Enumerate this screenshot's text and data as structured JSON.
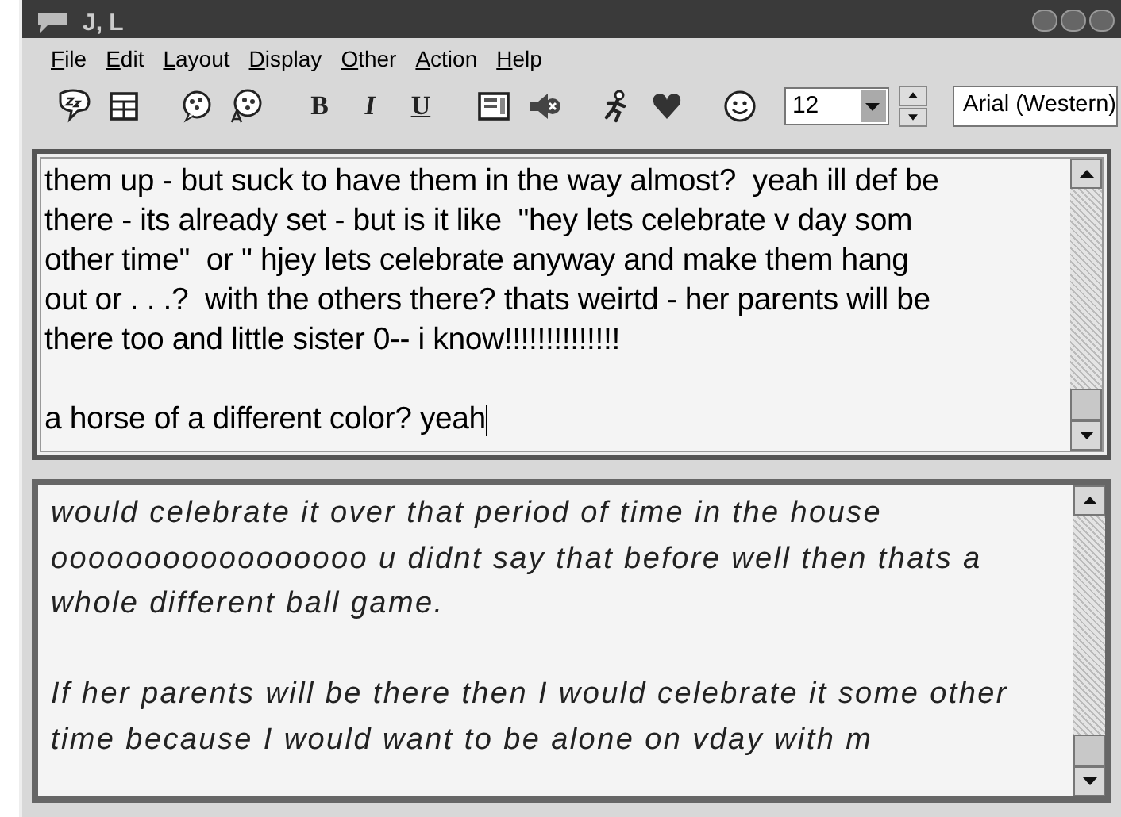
{
  "window": {
    "title": "J, L"
  },
  "menu": [
    "File",
    "Edit",
    "Layout",
    "Display",
    "Other",
    "Action",
    "Help"
  ],
  "format_buttons": [
    "B",
    "I",
    "U"
  ],
  "font_size": {
    "value": "12"
  },
  "font_name": {
    "value": "Arial (Western)"
  },
  "compose": {
    "paragraphs": [
      {
        "lines": [
          "them up - but suck to have them in the way almost?  yeah ill def be",
          "there - its already set - but is it like  \"hey lets celebrate v day som",
          "other time\"  or \" hjey lets celebrate anyway and make them hang",
          "out or . . .?  with the others there? thats weirtd - her parents will be",
          "there too and little sister 0-- i know!!!!!!!!!!!!!!"
        ]
      },
      {
        "lines": [
          "a horse of a different color? yeah"
        ]
      }
    ]
  },
  "history": {
    "paragraphs": [
      {
        "lines": [
          "would celebrate it over that period of time in the house",
          "ooooooooooooooooo u didnt say that before well then thats a",
          "whole different ball game."
        ]
      },
      {
        "lines": [
          "If her parents will be there then I would celebrate it some other",
          "time because I would want to be alone on vday with m"
        ]
      }
    ]
  }
}
